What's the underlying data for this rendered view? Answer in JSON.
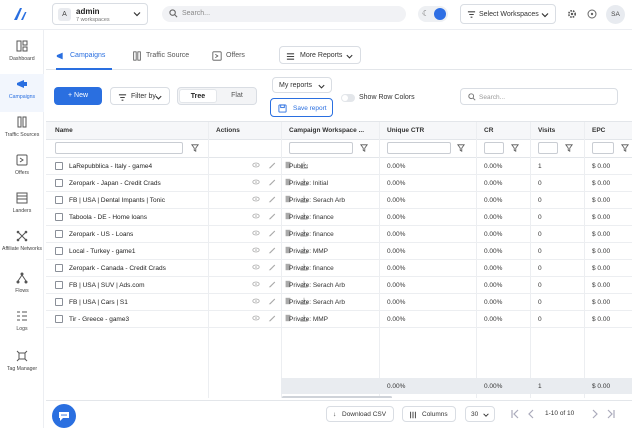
{
  "header": {
    "account": {
      "initial": "A",
      "name": "admin",
      "subtitle": "7 workspaces"
    },
    "search_placeholder": "Search...",
    "workspace_select": "Select Workspaces",
    "user_initials": "SA",
    "accent_color": "#2a6fe0"
  },
  "sidebar": {
    "items": [
      {
        "label": "Dashboard",
        "icon": "dashboard-icon"
      },
      {
        "label": "Campaigns",
        "icon": "campaigns-icon",
        "active": true
      },
      {
        "label": "Traffic Sources",
        "icon": "traffic-sources-icon"
      },
      {
        "label": "Offers",
        "icon": "offers-icon"
      },
      {
        "label": "Landers",
        "icon": "landers-icon"
      },
      {
        "label": "Affiliate Networks",
        "icon": "affiliate-networks-icon"
      },
      {
        "label": "Flows",
        "icon": "flows-icon"
      },
      {
        "label": "Logs",
        "icon": "logs-icon"
      },
      {
        "label": "Tag Manager",
        "icon": "tag-manager-icon"
      }
    ]
  },
  "tabs": {
    "campaigns": "Campaigns",
    "traffic_source": "Traffic Source",
    "offers": "Offers",
    "more_reports": "More Reports"
  },
  "toolbar": {
    "new_label": "New",
    "filter_label": "Filter by",
    "view_tree": "Tree",
    "view_flat": "Flat",
    "view_selected": "Tree",
    "my_reports": "My reports",
    "save_report": "Save report",
    "show_row_colors": "Show Row Colors",
    "search_placeholder": "Search..."
  },
  "table": {
    "columns": {
      "name": "Name",
      "actions": "Actions",
      "workspace": "Campaign Workspace ...",
      "ctr": "Unique CTR",
      "cr": "CR",
      "visits": "Visits",
      "epc": "EPC"
    },
    "rows": [
      {
        "name": "LaRepubblica - Italy - game4",
        "workspace": "Public:",
        "ctr": "0.00%",
        "cr": "0.00%",
        "visits": "1",
        "epc": "$ 0.00"
      },
      {
        "name": "Zeropark - Japan - Credit Crads",
        "workspace": "Private: Initial",
        "ctr": "0.00%",
        "cr": "0.00%",
        "visits": "0",
        "epc": "$ 0.00"
      },
      {
        "name": "FB | USA | Dental Impants | Tonic",
        "workspace": "Private: Serach Arb",
        "ctr": "0.00%",
        "cr": "0.00%",
        "visits": "0",
        "epc": "$ 0.00"
      },
      {
        "name": "Taboola - DE - Home loans",
        "workspace": "Private: finance",
        "ctr": "0.00%",
        "cr": "0.00%",
        "visits": "0",
        "epc": "$ 0.00"
      },
      {
        "name": "Zeropark - US - Loans",
        "workspace": "Private: finance",
        "ctr": "0.00%",
        "cr": "0.00%",
        "visits": "0",
        "epc": "$ 0.00"
      },
      {
        "name": "Local - Turkey - game1",
        "workspace": "Private: MMP",
        "ctr": "0.00%",
        "cr": "0.00%",
        "visits": "0",
        "epc": "$ 0.00"
      },
      {
        "name": "Zeropark - Canada - Credit Crads",
        "workspace": "Private: finance",
        "ctr": "0.00%",
        "cr": "0.00%",
        "visits": "0",
        "epc": "$ 0.00"
      },
      {
        "name": "FB | USA | SUV | Ads.com",
        "workspace": "Private: Serach Arb",
        "ctr": "0.00%",
        "cr": "0.00%",
        "visits": "0",
        "epc": "$ 0.00"
      },
      {
        "name": "FB | USA | Cars | S1",
        "workspace": "Private: Serach Arb",
        "ctr": "0.00%",
        "cr": "0.00%",
        "visits": "0",
        "epc": "$ 0.00"
      },
      {
        "name": "Tir - Greece - game3",
        "workspace": "Private: MMP",
        "ctr": "0.00%",
        "cr": "0.00%",
        "visits": "0",
        "epc": "$ 0.00"
      }
    ],
    "totals": {
      "ctr": "0.00%",
      "cr": "0.00%",
      "visits": "1",
      "epc": "$ 0.00"
    }
  },
  "footer": {
    "download_csv": "Download CSV",
    "columns": "Columns",
    "page_size": "30",
    "page_info": "1-10 of 10"
  }
}
